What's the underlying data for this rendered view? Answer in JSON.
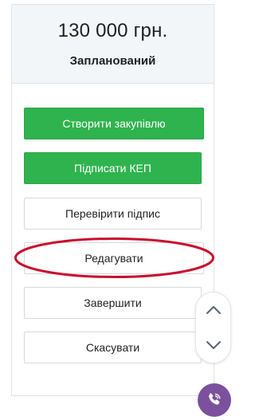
{
  "summary": {
    "price": "130 000 грн.",
    "status": "Запланований"
  },
  "actions": {
    "create_procurement": "Створити закупівлю",
    "sign_kep": "Підписати КЕП",
    "check_signature": "Перевірити підпис",
    "edit": "Редагувати",
    "finish": "Завершити",
    "cancel": "Скасувати"
  },
  "colors": {
    "primary_green": "#2fb34f",
    "header_bg": "#f3f6f9",
    "highlight_red": "#c8102e",
    "viber_purple": "#7b519d"
  },
  "icons": {
    "scroll_up": "chevron-up-icon",
    "scroll_down": "chevron-down-icon",
    "messenger": "viber-icon"
  }
}
